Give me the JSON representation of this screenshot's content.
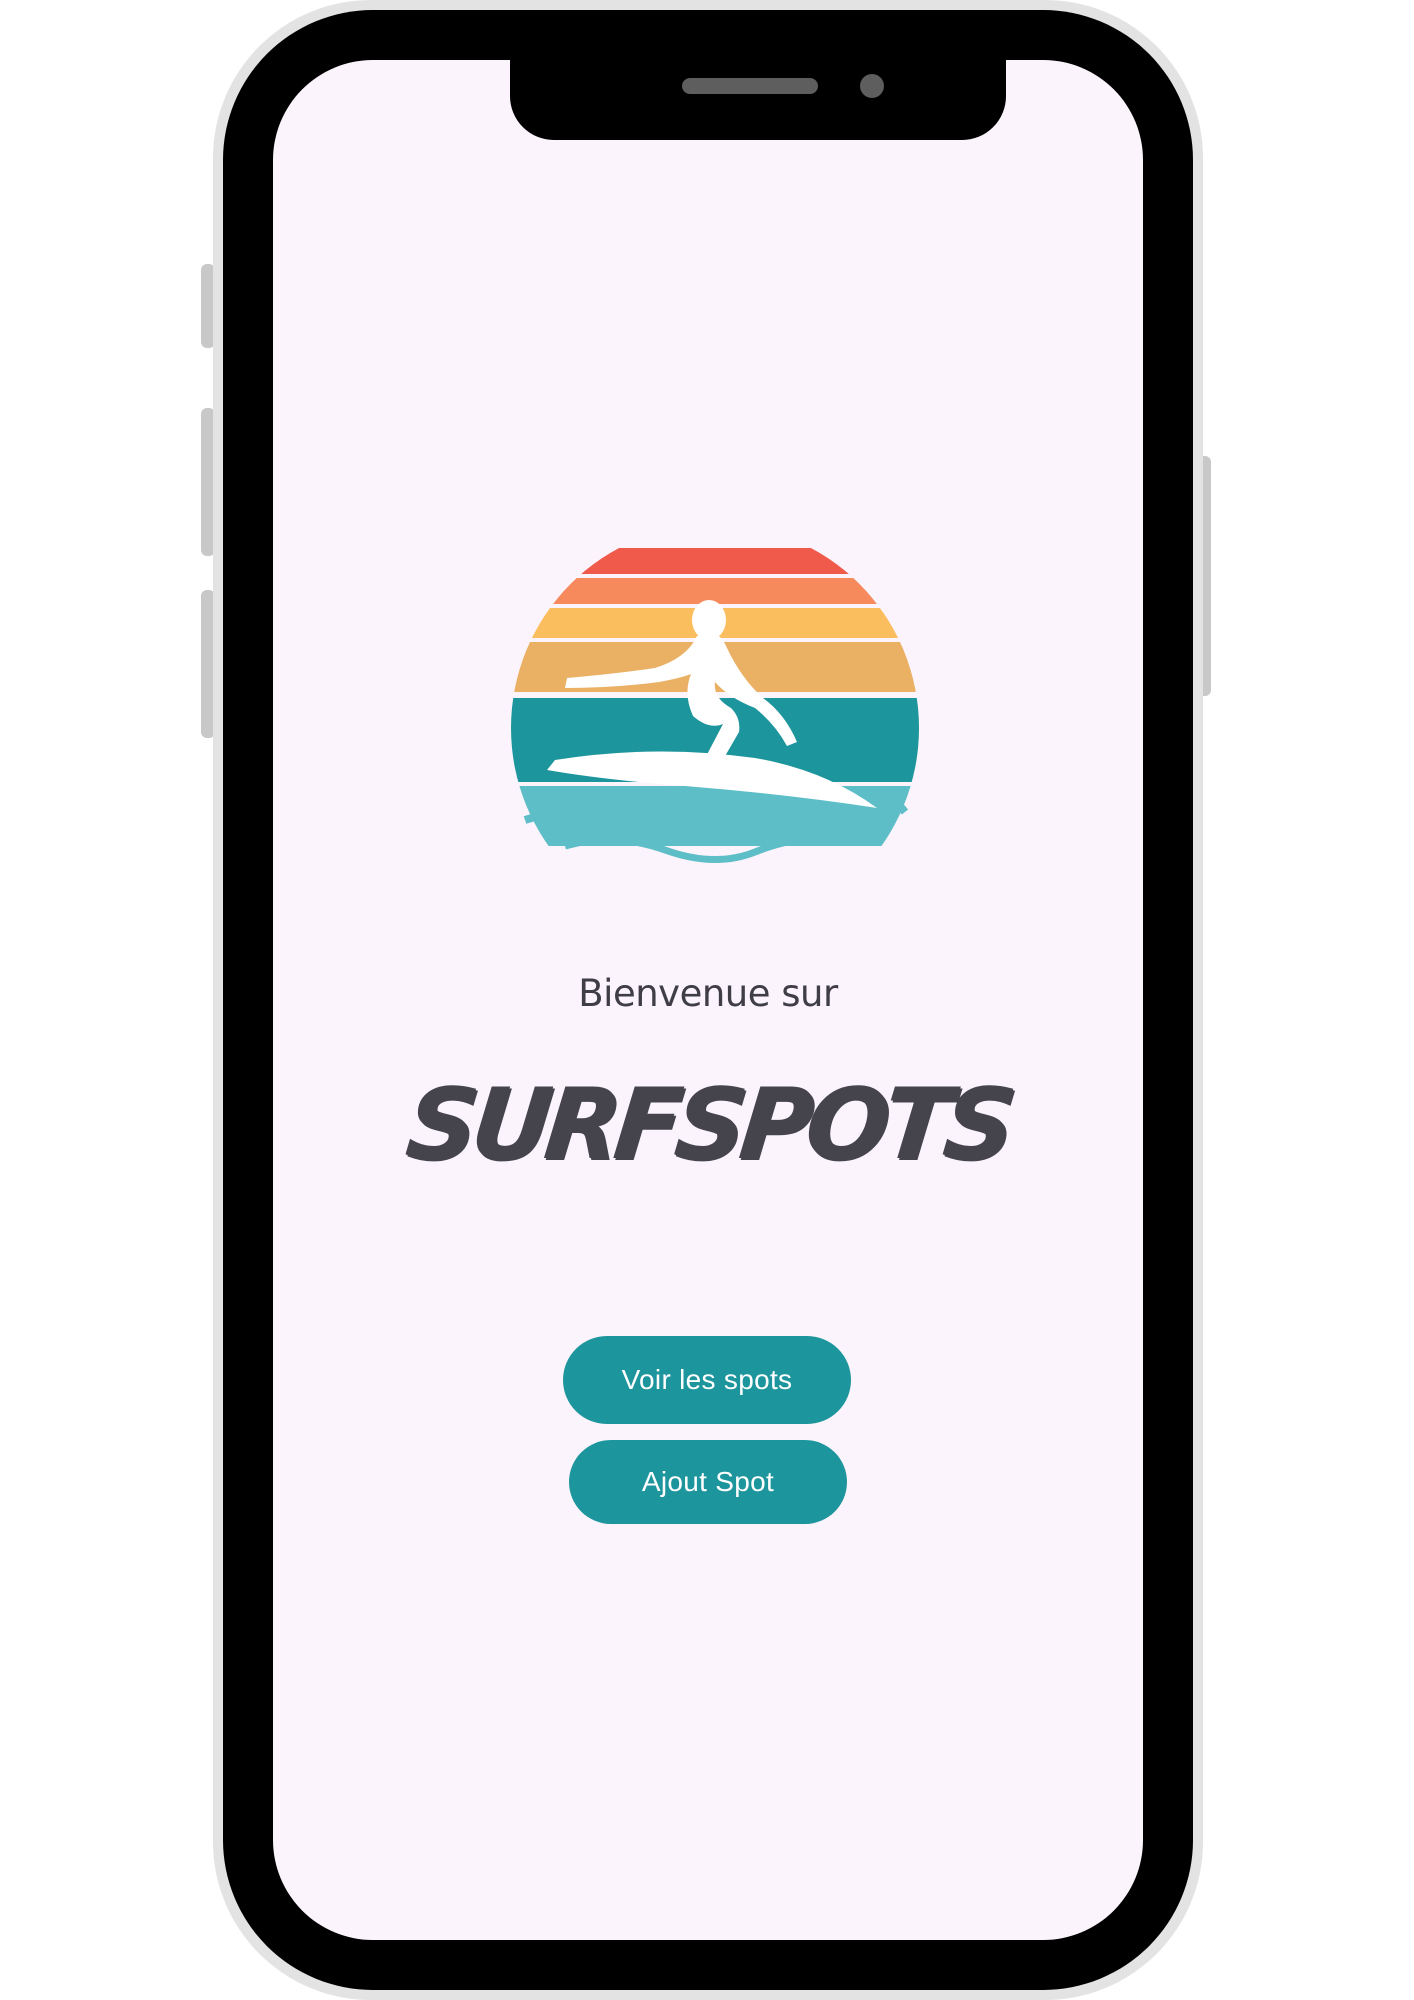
{
  "screen": {
    "welcome_text": "Bienvenue sur",
    "brand_name": "SURFSPOTS",
    "logo_icon": "surfer-sunset-logo"
  },
  "buttons": {
    "view_spots_label": "Voir les spots",
    "add_spot_label": "Ajout Spot"
  },
  "colors": {
    "background": "#fcf4fc",
    "button": "#1d959c",
    "button_text": "#ffffff",
    "text": "#3f3d45",
    "sun_red": "#ef5a4a",
    "sun_orange": "#f68a5c",
    "sun_yellow": "#fbbe5f",
    "sun_tan": "#eab064",
    "sea_teal": "#1c959c",
    "sea_light": "#5dbec7"
  }
}
